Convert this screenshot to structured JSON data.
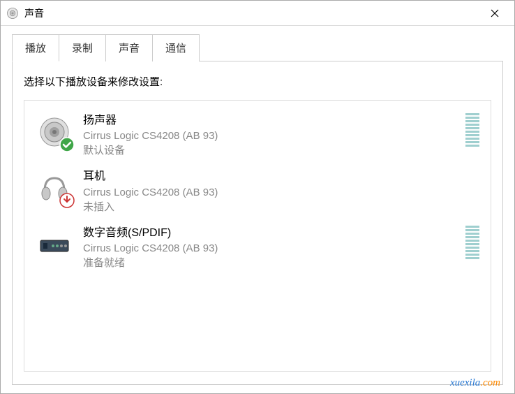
{
  "window": {
    "title": "声音"
  },
  "tabs": [
    {
      "label": "播放",
      "active": true
    },
    {
      "label": "录制",
      "active": false
    },
    {
      "label": "声音",
      "active": false
    },
    {
      "label": "通信",
      "active": false
    }
  ],
  "instruction": "选择以下播放设备来修改设置:",
  "devices": [
    {
      "name": "扬声器",
      "description": "Cirrus Logic CS4208 (AB 93)",
      "status": "默认设备",
      "icon": "speaker",
      "badge": "check",
      "meter": true
    },
    {
      "name": "耳机",
      "description": "Cirrus Logic CS4208 (AB 93)",
      "status": "未插入",
      "icon": "headphones",
      "badge": "down-arrow",
      "meter": false
    },
    {
      "name": "数字音频(S/PDIF)",
      "description": "Cirrus Logic CS4208 (AB 93)",
      "status": "准备就绪",
      "icon": "digital",
      "badge": null,
      "meter": true
    }
  ],
  "watermark": {
    "blue": "xuexila",
    "orange": ".com"
  }
}
